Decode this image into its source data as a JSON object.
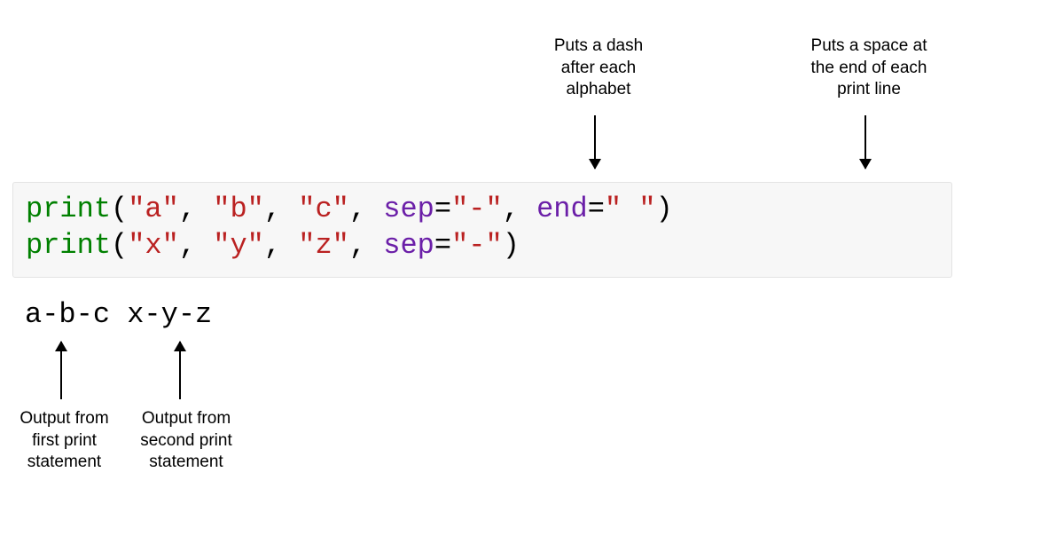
{
  "annotations": {
    "sep_note": "Puts a dash\nafter each\nalphabet",
    "end_note": "Puts a space at\nthe end of each\nprint line",
    "out1_note": "Output from\nfirst print\nstatement",
    "out2_note": "Output from\nsecond print\nstatement"
  },
  "code": {
    "line1": {
      "func": "print",
      "open": "(",
      "s1": "\"a\"",
      "c1": ", ",
      "s2": "\"b\"",
      "c2": ", ",
      "s3": "\"c\"",
      "c3": ", ",
      "sep_kw": "sep",
      "sep_eq": "=",
      "sep_val": "\"-\"",
      "c4": ", ",
      "end_kw": "end",
      "end_eq": "=",
      "end_val": "\" \"",
      "close": ")"
    },
    "line2": {
      "func": "print",
      "open": "(",
      "s1": "\"x\"",
      "c1": ", ",
      "s2": "\"y\"",
      "c2": ", ",
      "s3": "\"z\"",
      "c3": ", ",
      "sep_kw": "sep",
      "sep_eq": "=",
      "sep_val": "\"-\"",
      "close": ")"
    }
  },
  "output": {
    "text": "a-b-c x-y-z"
  }
}
